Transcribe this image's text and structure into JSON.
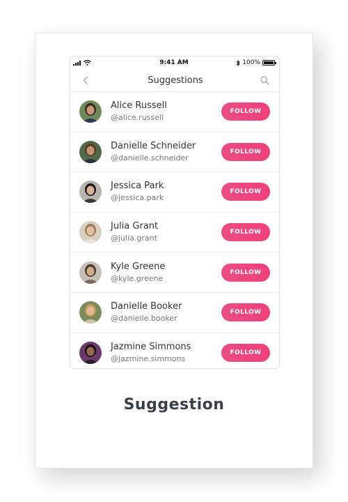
{
  "status_bar": {
    "time": "9:41 AM",
    "battery": "100%",
    "battery_level": 1.0
  },
  "nav": {
    "title": "Suggestions",
    "back_icon": "chevron-left-icon",
    "search_icon": "search-icon"
  },
  "users": [
    {
      "name": "Alice Russell",
      "handle": "@alice.russell",
      "button": "FOLLOW",
      "skin": "#c99a7a",
      "hair": "#3a2a20",
      "bg": "#6e8a5a",
      "shirt": "#2b3a55"
    },
    {
      "name": "Danielle Schneider",
      "handle": "@danielle.schneider",
      "button": "FOLLOW",
      "skin": "#c89476",
      "hair": "#5a3b26",
      "bg": "#4e6a48",
      "shirt": "#2a3240"
    },
    {
      "name": "Jessica Park",
      "handle": "@jessica.park",
      "button": "FOLLOW",
      "skin": "#d7b29a",
      "hair": "#1e1a1a",
      "bg": "#b8b4b0",
      "shirt": "#3a3a3a"
    },
    {
      "name": "Julia Grant",
      "handle": "@julia.grant",
      "button": "FOLLOW",
      "skin": "#e2c0a4",
      "hair": "#a07a55",
      "bg": "#d8cfc0",
      "shirt": "#e8e2d8"
    },
    {
      "name": "Kyle Greene",
      "handle": "@kyle.greene",
      "button": "FOLLOW",
      "skin": "#d3aa8c",
      "hair": "#4a3a30",
      "bg": "#c4c0b8",
      "shirt": "#7a6a5a"
    },
    {
      "name": "Danielle Booker",
      "handle": "@danielle.booker",
      "button": "FOLLOW",
      "skin": "#e0b894",
      "hair": "#c09a5a",
      "bg": "#7a8a5a",
      "shirt": "#d0c2a8"
    },
    {
      "name": "Jazmine Simmons",
      "handle": "@jazmine.simmons",
      "button": "FOLLOW",
      "skin": "#9a6a50",
      "hair": "#1a1010",
      "bg": "#6a3a6a",
      "shirt": "#2a1a2a"
    }
  ],
  "caption": "Suggestion",
  "colors": {
    "accent": "#ee4680",
    "caption": "#3b3f4a"
  }
}
